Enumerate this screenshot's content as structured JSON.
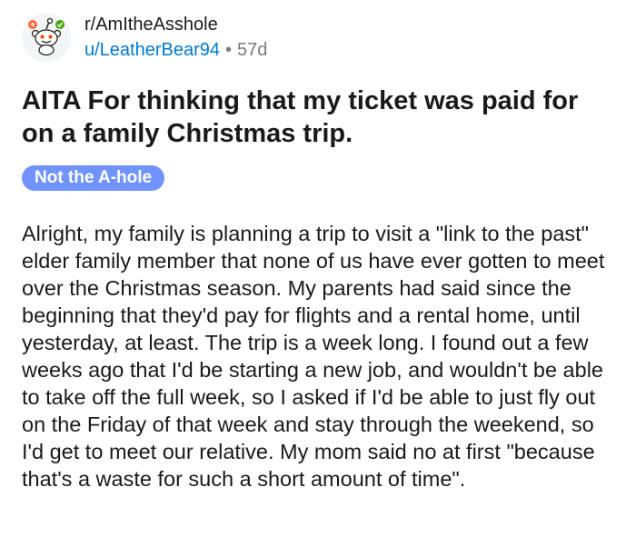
{
  "post": {
    "subreddit": "r/AmItheAsshole",
    "author": "u/LeatherBear94",
    "separator": "•",
    "age": "57d",
    "title": "AITA For thinking that my ticket was paid for on a family Christmas trip.",
    "flair": "Not the A-hole",
    "body": "Alright, my family is planning a trip to visit a \"link to the past\" elder family member that none of us have ever gotten to meet over the Christmas season. My parents had said since the beginning that they'd pay for flights and a rental home, until yesterday, at least. The trip is a week long. I found out a few weeks ago that I'd be starting a new job, and wouldn't be able to take off the full week, so I asked if I'd be able to just fly out on the Friday of that week and stay through the weekend, so I'd get to meet our relative. My mom said no at first \"because that's a waste for such a short amount of time\"."
  },
  "icons": {
    "avatar": "snoo-avatar-icon"
  },
  "colors": {
    "username": "#0079d3",
    "flair_background": "#7193ff",
    "flair_text": "#ffffff",
    "meta_gray": "#787c7e"
  }
}
